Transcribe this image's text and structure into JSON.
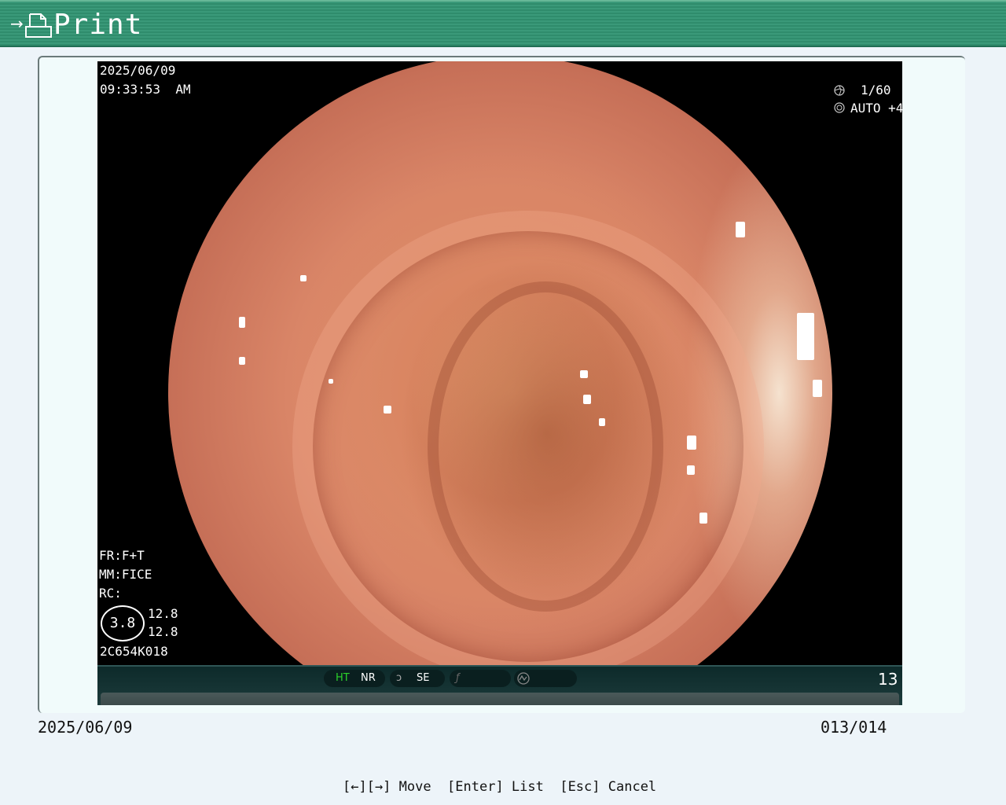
{
  "window": {
    "title": "Print",
    "title_icon": "print-icon",
    "title_arrow_icon": "arrow-right-icon"
  },
  "image_overlay": {
    "date": "2025/06/09",
    "time": "09:33:53  AM",
    "shutter_icon": "shutter-icon",
    "shutter": "1/60",
    "iris_icon": "iris-icon",
    "iris": "AUTO +4",
    "fr": "FR:F+T",
    "mm": "MM:FICE",
    "rc": "RC:",
    "lens_value": "3.8",
    "lens_val_top": "12.8",
    "lens_val_bottom": "12.8",
    "scope_id": "2C654K018"
  },
  "status_strip": {
    "ht": "HT",
    "nr": "NR",
    "se_icon": "scope-tip-icon",
    "se": "SE",
    "flag_icon": "function-icon",
    "mode_icon": "wave-circle-icon",
    "count": "13",
    "ht_color": "#2bd32b"
  },
  "footer": {
    "date": "2025/06/09",
    "page": "013/014",
    "help": "[←][→] Move  [Enter] List  [Esc] Cancel"
  },
  "colors": {
    "title_bar": "#2f8c6c",
    "background": "#edf4f9",
    "panel": "#f1fbfb"
  }
}
